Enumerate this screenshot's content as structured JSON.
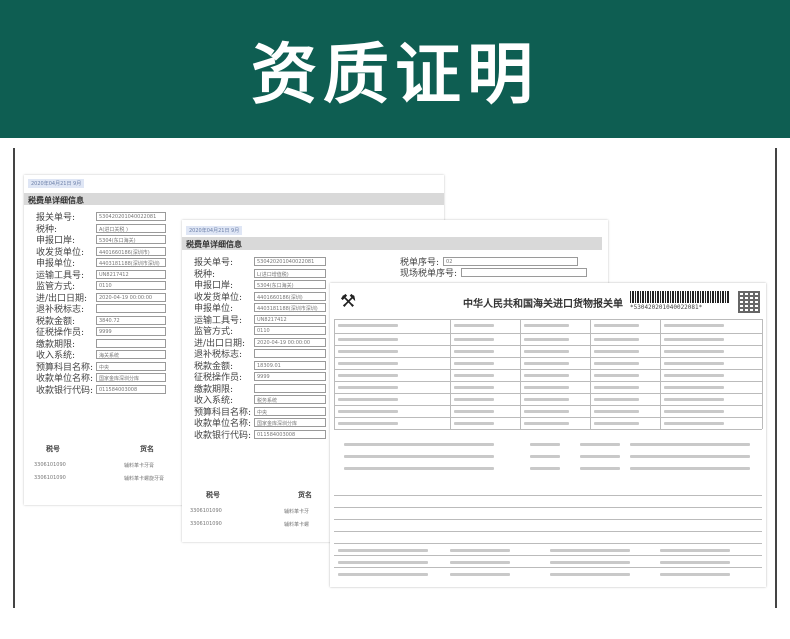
{
  "banner": {
    "title": "资质证明",
    "bg": "#0e5e52"
  },
  "doc_back": {
    "date": "2020年04月21日 9月",
    "heading": "税费单详细信息",
    "fields": [
      {
        "label": "报关单号:",
        "value": "530420201040022081"
      },
      {
        "label": "税种:",
        "value": "A(进口关税 )"
      },
      {
        "label": "申报口岸:",
        "value": "5304(东口海关)"
      },
      {
        "label": "收发货单位:",
        "value": "4401660186(深圳市)"
      },
      {
        "label": "申报单位:",
        "value": "4403181188(深圳市深圳)"
      },
      {
        "label": "运输工具号:",
        "value": "UN8217412"
      },
      {
        "label": "监管方式:",
        "value": "0110"
      },
      {
        "label": "进/出口日期:",
        "value": "2020-04-19 00:00:00"
      },
      {
        "label": "退补税标志:",
        "value": ""
      },
      {
        "label": "税款金额:",
        "value": "3840.72"
      },
      {
        "label": "征税操作员:",
        "value": "9999"
      },
      {
        "label": "缴款期限:",
        "value": ""
      },
      {
        "label": "收入系统:",
        "value": "海关系统"
      },
      {
        "label": "预算科目名称:",
        "value": "中央"
      },
      {
        "label": "收款单位名称:",
        "value": "国家金库深圳分库"
      },
      {
        "label": "收款银行代码:",
        "value": "011584003008"
      }
    ],
    "table_heads": [
      "税号",
      "货名"
    ],
    "table_rows": [
      [
        "3306101090",
        "辅料革卡牙膏"
      ],
      [
        "3306101090",
        "辅料革卡螺旋牙膏"
      ]
    ]
  },
  "doc_mid": {
    "date": "2020年04月21日 9月",
    "heading": "税费单详细信息",
    "fields": [
      {
        "label": "报关单号:",
        "value": "530420201040022081"
      },
      {
        "label": "税种:",
        "value": "L(进口增值税)"
      },
      {
        "label": "申报口岸:",
        "value": "5304(东口海关)"
      },
      {
        "label": "收发货单位:",
        "value": "4401660186(深圳)"
      },
      {
        "label": "申报单位:",
        "value": "4403181188(深圳市深圳)"
      },
      {
        "label": "运输工具号:",
        "value": "UN8217412"
      },
      {
        "label": "监管方式:",
        "value": "0110"
      },
      {
        "label": "进/出口日期:",
        "value": "2020-04-19 00:00:00"
      },
      {
        "label": "退补税标志:",
        "value": ""
      },
      {
        "label": "税款金额:",
        "value": "18309.01"
      },
      {
        "label": "征税操作员:",
        "value": "9999"
      },
      {
        "label": "缴款期限:",
        "value": ""
      },
      {
        "label": "收入系统:",
        "value": "税务系统"
      },
      {
        "label": "预算科目名称:",
        "value": "中央"
      },
      {
        "label": "收款单位名称:",
        "value": "国家金库深圳分库"
      },
      {
        "label": "收款银行代码:",
        "value": "011584003008"
      }
    ],
    "side_fields": [
      {
        "label": "税单序号:",
        "value": "02"
      },
      {
        "label": "现场税单序号:",
        "value": ""
      }
    ],
    "table_heads": [
      "税号",
      "货名"
    ],
    "table_rows": [
      [
        "3306101090",
        "辅料革卡牙"
      ],
      [
        "3306101090",
        "辅料革卡螺"
      ]
    ]
  },
  "customs": {
    "title": "中华人民共和国海关进口货物报关单",
    "barcode_number": "*530420201040022081*"
  }
}
